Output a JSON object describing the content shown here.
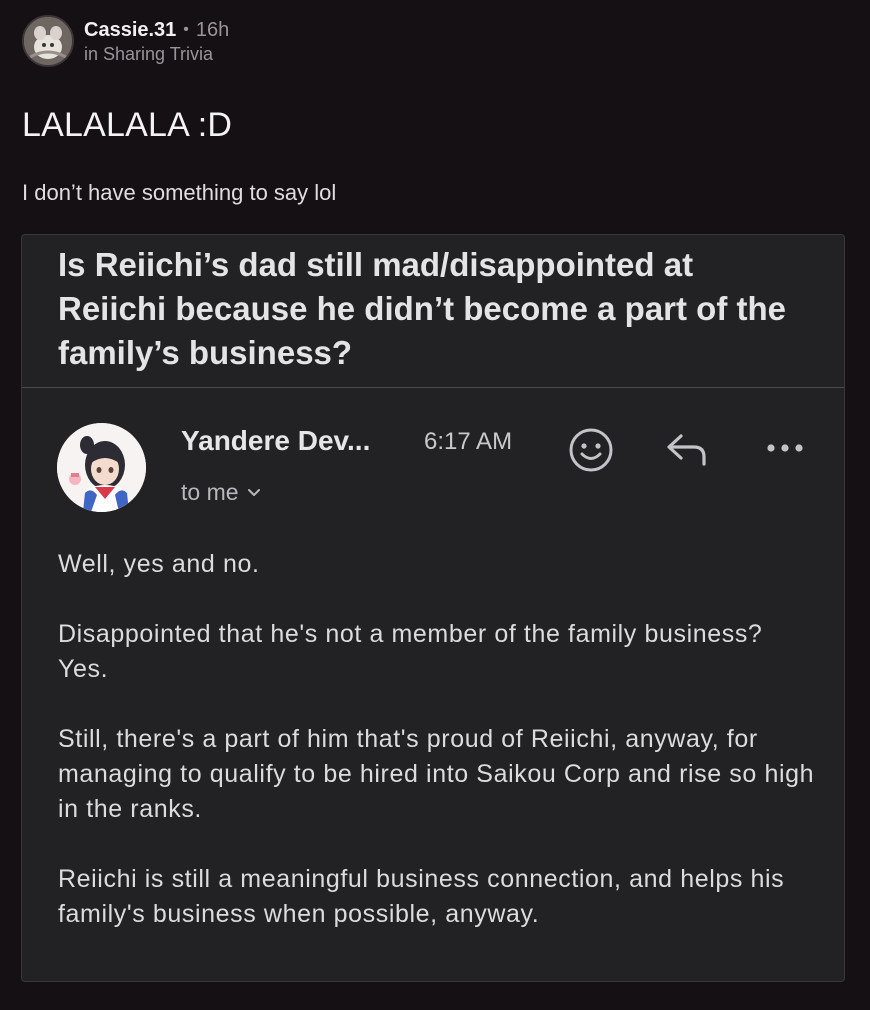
{
  "post": {
    "username": "Cassie.31",
    "separator": "•",
    "time": "16h",
    "community": "in Sharing Trivia",
    "title": "LALALALA :D",
    "body": "I don’t have something to say lol"
  },
  "email": {
    "subject": "Is Reiichi’s dad still mad/disappointed at Reiichi because he didn’t become a part of the family’s business?",
    "sender": "Yandere Dev...",
    "time": "6:17 AM",
    "recipient_label": "to me",
    "icons": {
      "emoji": "smiley-face-icon",
      "reply": "reply-arrow-icon",
      "more": "more-options-icon",
      "chevron": "chevron-down-icon"
    },
    "paragraphs": [
      "Well, yes and no.",
      "Disappointed that he's not a member of the family business? Yes.",
      "Still, there's a part of him that's proud of Reiichi, anyway, for managing to qualify to be hired into Saikou Corp and rise so high in the ranks.",
      "Reiichi is still a meaningful business connection, and helps his family's business when possible, anyway."
    ]
  }
}
